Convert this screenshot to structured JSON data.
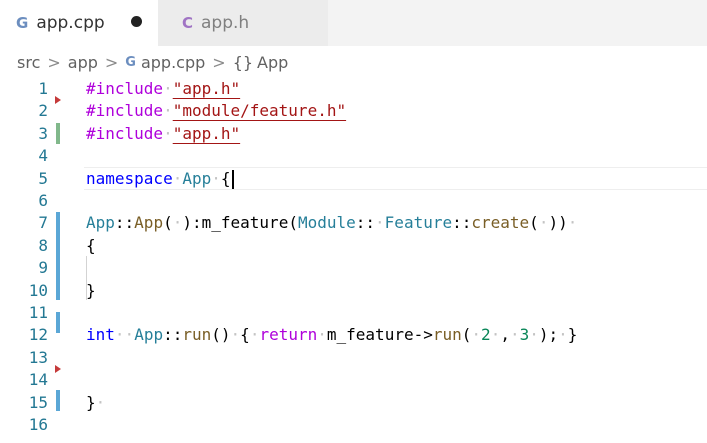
{
  "tabs": [
    {
      "label": "app.cpp",
      "icon": "cpp-file-icon",
      "active": true,
      "dirty": true
    },
    {
      "label": "app.h",
      "icon": "c-header-file-icon",
      "active": false,
      "dirty": false
    }
  ],
  "breadcrumb": {
    "items": [
      "src",
      "app",
      "app.cpp",
      "App"
    ],
    "file_icon_glyph": "G",
    "symbol_icon_glyph": "{}",
    "separator": ">"
  },
  "tab_icons": {
    "cpp": "G",
    "h": "C"
  },
  "line_numbers": [
    "1",
    "2",
    "3",
    "4",
    "5",
    "6",
    "7",
    "8",
    "9",
    "10",
    "11",
    "12",
    "13",
    "14",
    "15",
    "16"
  ],
  "code": {
    "include": "#include",
    "inc1": "\"app.h\"",
    "inc2": "\"module/feature.h\"",
    "inc3": "\"app.h\"",
    "namespace_kw": "namespace",
    "namespace_name": "App",
    "brace_open": "{",
    "brace_close": "}",
    "ctor_class": "App",
    "scope": "::",
    "ctor_name": "App",
    "ctor_paren_open": "(",
    "ctor_paren_close": "):",
    "member": "m_feature",
    "paren_open": "(",
    "module_ns": "Module",
    "feature_cls": "Feature",
    "create_fn": "create",
    "call_parens_close": "))",
    "int_kw": "int",
    "run_class": "App",
    "run_fn": "run",
    "empty_parens": "()",
    "return_kw": "return",
    "arrow": "->",
    "num1": "2",
    "comma": ",",
    "num2": "3",
    "close_semicolon": ");",
    "ws_dot": "·"
  },
  "colors": {
    "keyword": "#0000ff",
    "include": "#af00db",
    "string": "#a31515",
    "type": "#267f99",
    "function": "#795e26",
    "number": "#098658",
    "line_number": "#237893",
    "added_bar": "#81b88b",
    "modified_bar": "#5ba7d6",
    "deleted_marker": "#c53a3a"
  }
}
